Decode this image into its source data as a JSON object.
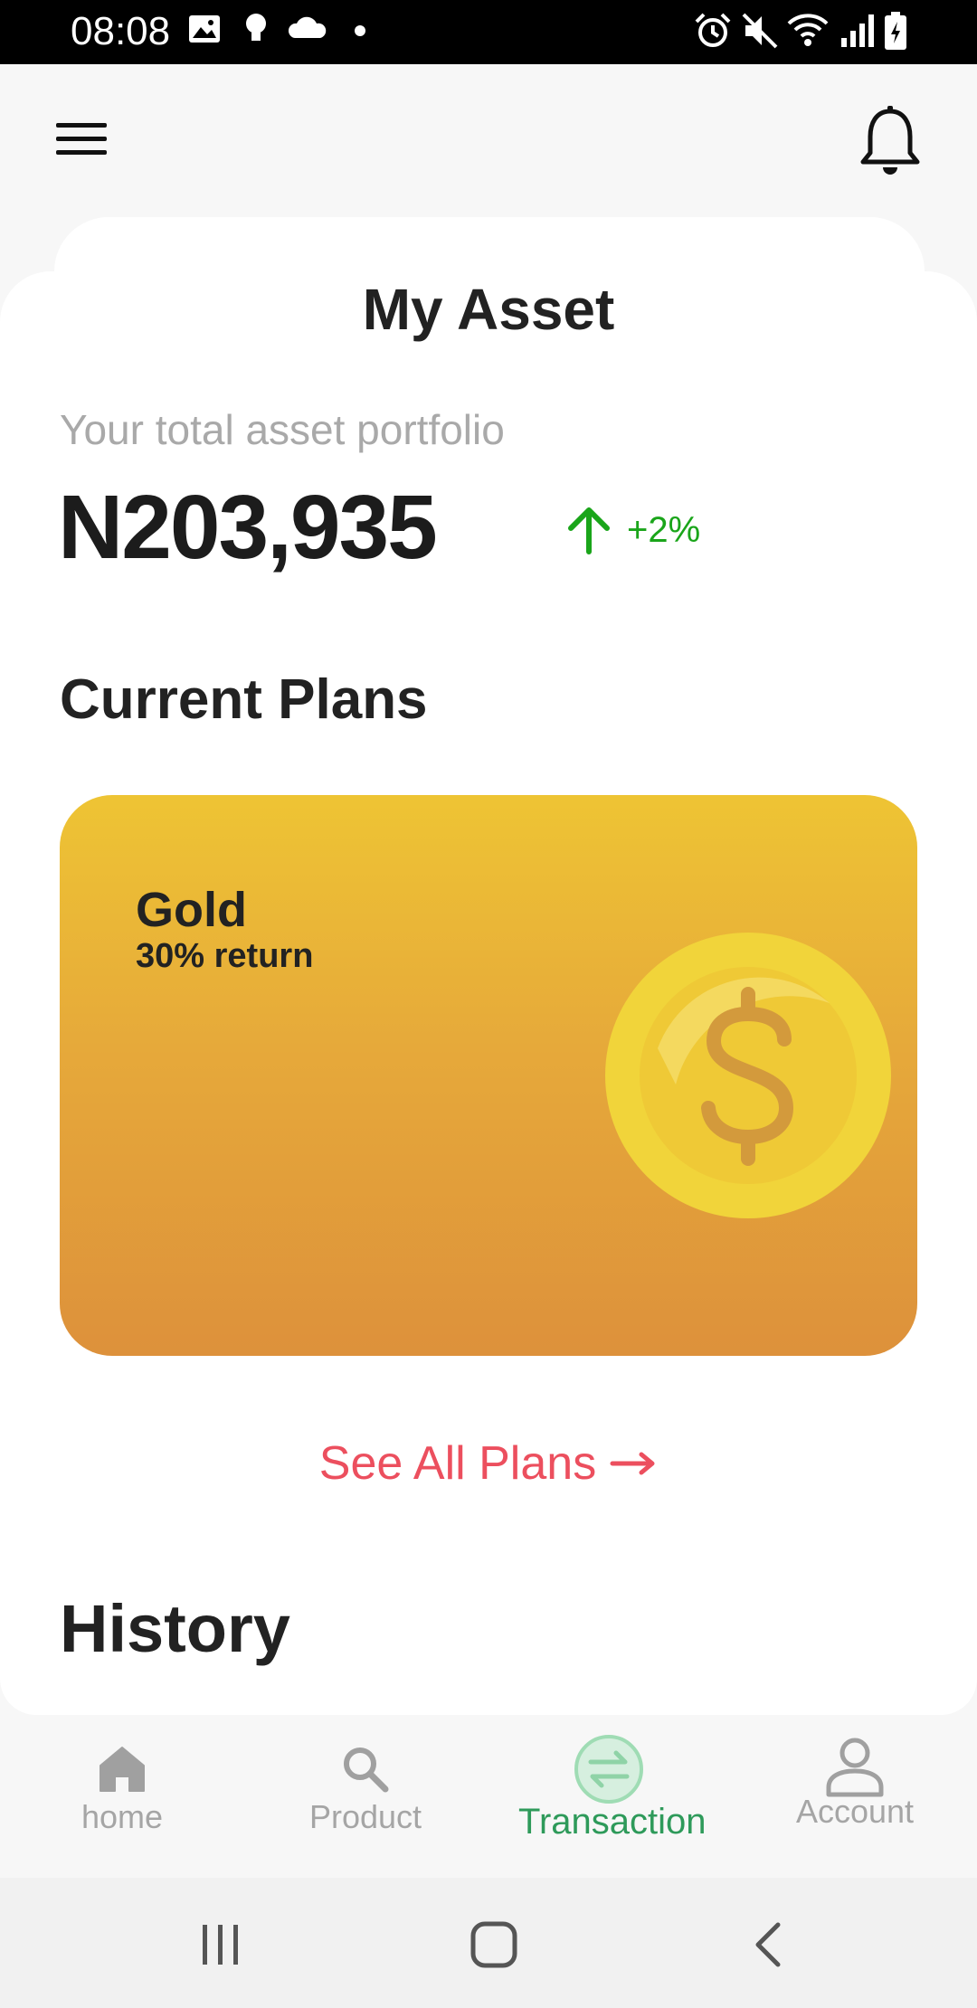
{
  "status_bar": {
    "time": "08:08",
    "left_icons": [
      "gallery-icon",
      "bulb-icon",
      "cloud-icon",
      "dot-icon"
    ],
    "right_icons": [
      "alarm-icon",
      "mute-icon",
      "wifi-icon",
      "signal-icon",
      "battery-icon"
    ]
  },
  "header": {
    "menu_icon": "hamburger-menu-icon",
    "notification_icon": "bell-icon"
  },
  "asset": {
    "title": "My Asset",
    "portfolio_label": "Your total asset portfolio",
    "portfolio_value": "N203,935",
    "change": "+2%",
    "change_color": "#1aa51a"
  },
  "plans": {
    "section_title": "Current Plans",
    "cards": [
      {
        "name": "Gold",
        "return": "30% return",
        "icon": "dollar-coin-icon"
      }
    ],
    "see_all_label": "See All Plans",
    "see_all_color": "#ec4f5e"
  },
  "history": {
    "title": "History"
  },
  "bottom_nav": {
    "items": [
      {
        "label": "home",
        "icon": "home-icon",
        "active": false
      },
      {
        "label": "Product",
        "icon": "search-icon",
        "active": false
      },
      {
        "label": "Transaction",
        "icon": "transfer-icon",
        "active": true
      },
      {
        "label": "Account",
        "icon": "person-icon",
        "active": false
      }
    ],
    "active_color": "#2e9a5a"
  },
  "system_nav": {
    "buttons": [
      "recent-apps-icon",
      "home-circle-icon",
      "back-icon"
    ]
  }
}
